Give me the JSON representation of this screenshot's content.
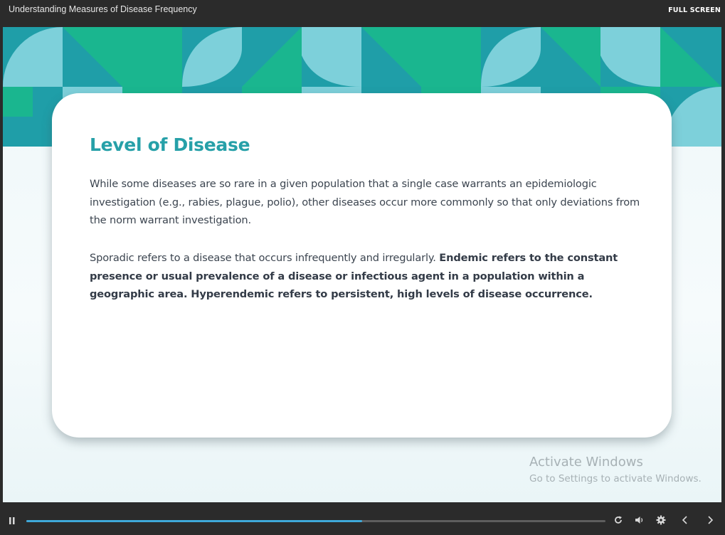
{
  "header": {
    "course_title": "Understanding Measures of Disease Frequency",
    "fullscreen_label": "FULL SCREEN"
  },
  "slide": {
    "title": "Level of Disease",
    "paragraph1": "While some diseases are so rare in a given population that a single case warrants an epidemiologic investigation (e.g., rabies, plague, polio), other diseases occur more commonly so that only deviations from the norm warrant investigation.",
    "paragraph2_plain": "Sporadic refers to a disease that occurs infrequently and irregularly. ",
    "paragraph2_bold": "Endemic refers to the constant presence or usual prevalence of a disease or infectious agent in a population within a geographic area. Hyperendemic refers to persistent, high levels of disease occurrence."
  },
  "watermark": {
    "line1": "Activate Windows",
    "line2": "Go to Settings to activate Windows."
  },
  "player": {
    "progress_fraction": 0.58,
    "icons": [
      "pause-icon",
      "replay-icon",
      "volume-icon",
      "settings-icon",
      "prev-icon",
      "next-icon"
    ]
  },
  "colors": {
    "accent_title": "#26a0a8",
    "progress": "#3fa9d9",
    "teal": "#1f9ea8",
    "green": "#1ab68f",
    "light_teal": "#7dd0da"
  }
}
